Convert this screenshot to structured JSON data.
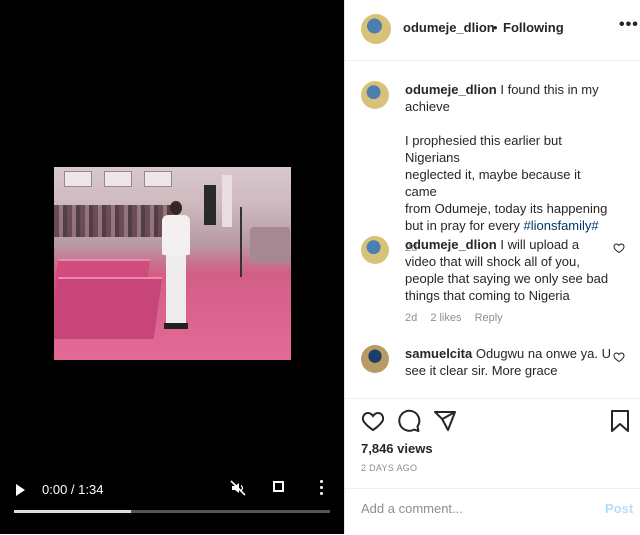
{
  "video": {
    "time_display": "0:00 / 1:34",
    "progress_fraction": 0.37
  },
  "header": {
    "username": "odumeje_dlion",
    "separator": "•",
    "follow_status": "Following",
    "more": "•••"
  },
  "comments": [
    {
      "username": "odumeje_dlion",
      "lines": [
        "I found this in my",
        "achieve",
        "",
        "I prophesied this earlier but Nigerians",
        "neglected it, maybe because it came",
        "from Odumeje, today its happening",
        "but in pray for every "
      ],
      "hashtag": "#lionsfamily#",
      "time": "2d"
    },
    {
      "username": "odumeje_dlion",
      "text": "I will upload a video that will shock all of you, people that saying we only see bad things that coming to Nigeria",
      "time": "2d",
      "likes": "2 likes",
      "reply": "Reply"
    },
    {
      "username": "samuelcita",
      "text": "Odugwu na onwe ya. U see it clear sir. More grace"
    }
  ],
  "post": {
    "views": "7,846 views",
    "date": "2 DAYS AGO"
  },
  "comment_box": {
    "placeholder": "Add a comment...",
    "post_label": "Post"
  },
  "colors": {
    "hashtag": "#00376b",
    "post_disabled": "#b2dffc"
  }
}
